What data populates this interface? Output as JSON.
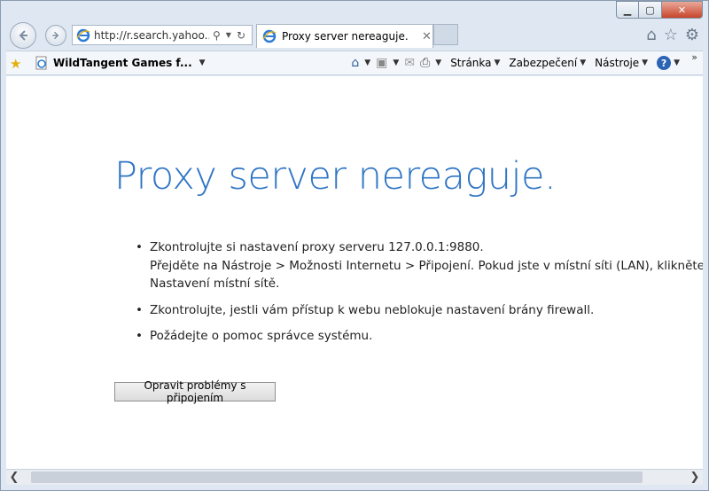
{
  "window": {
    "min_icon": "minimize-icon",
    "max_icon": "maximize-icon",
    "close_icon": "close-icon"
  },
  "nav": {
    "address": "http://r.search.yahoo....",
    "tab_title": "Proxy server nereaguje.",
    "tab_close": "✕"
  },
  "commandbar": {
    "favorite_label": "WildTangent Games f...",
    "menu_page": "Stránka",
    "menu_security": "Zabezpečení",
    "menu_tools": "Nástroje",
    "help": "?"
  },
  "content": {
    "title": "Proxy server nereaguje.",
    "bullet1_line1_prefix": "Zkontrolujte si nastavení proxy serveru ",
    "bullet1_proxy": "127.0.0.1:9880",
    "bullet1_line1_suffix": ".",
    "bullet1_line2": "Přejděte na Nástroje > Možnosti Internetu > Připojení. Pokud jste v místní síti (LAN), klikněte na",
    "bullet1_line3": "Nastavení místní sítě.",
    "bullet2": "Zkontrolujte, jestli vám přístup k webu neblokuje nastavení brány firewall.",
    "bullet3": "Požádejte o pomoc správce systému.",
    "fix_button": "Opravit problémy s připojením"
  },
  "colors": {
    "title_blue": "#2f75c4",
    "close_red": "#c7452b"
  }
}
